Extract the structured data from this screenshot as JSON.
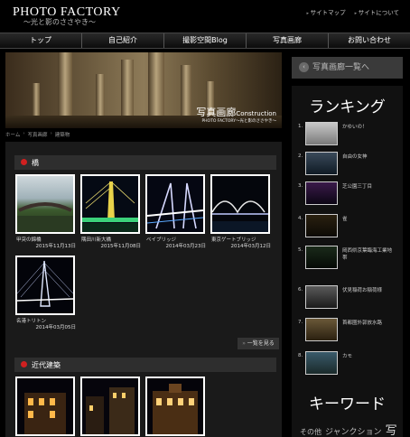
{
  "header": {
    "site_title": "PHOTO FACTORY",
    "site_subtitle": "〜光と影のささやき〜",
    "links": [
      "サイトマップ",
      "サイトについて"
    ]
  },
  "nav": [
    "トップ",
    "自己紹介",
    "撮影空間Blog",
    "写真画廊",
    "お問い合わせ"
  ],
  "hero": {
    "title": "写真画廊",
    "title_en": "Construction",
    "subtitle": "PHOTO FACTORY〜光と影のささやき〜"
  },
  "breadcrumb": [
    "ホーム",
    "写真画廊",
    "建築物"
  ],
  "sections": [
    {
      "title": "橋",
      "items": [
        {
          "name": "甲突の錦橋",
          "date": "2015年11月13日"
        },
        {
          "name": "隅田川新大橋",
          "date": "2015年11月08日"
        },
        {
          "name": "ベイブリッジ",
          "date": "2014年03月23日"
        },
        {
          "name": "東京ゲートブリッジ",
          "date": "2014年03月12日"
        },
        {
          "name": "名港トリトン",
          "date": "2014年03月05日"
        }
      ],
      "more_label": "一覧を見る"
    },
    {
      "title": "近代建築",
      "items": [
        {
          "name": "",
          "date": ""
        },
        {
          "name": "",
          "date": ""
        },
        {
          "name": "",
          "date": ""
        }
      ]
    }
  ],
  "sidebar": {
    "gallery_button": "写真画廊一覧へ",
    "ranking_title": "ランキング",
    "ranking": [
      {
        "num": "1.",
        "label": "かゆいの！"
      },
      {
        "num": "2.",
        "label": "自由の女神"
      },
      {
        "num": "3.",
        "label": "芝公園三丁目"
      },
      {
        "num": "4.",
        "label": "雀"
      },
      {
        "num": "5.",
        "label": "岡西県京葉臨海工業地帯"
      },
      {
        "num": "6.",
        "label": "伏見稲荷お稲荷様"
      },
      {
        "num": "7.",
        "label": "首都圏外郭放水路"
      },
      {
        "num": "8.",
        "label": "カモ"
      }
    ],
    "keyword_title": "キーワード",
    "keywords": [
      "その他",
      "ジャンクション",
      "写"
    ]
  },
  "colors": {
    "accent_red": "#d02020",
    "background": "#000000",
    "panel": "#1a1a1a"
  }
}
